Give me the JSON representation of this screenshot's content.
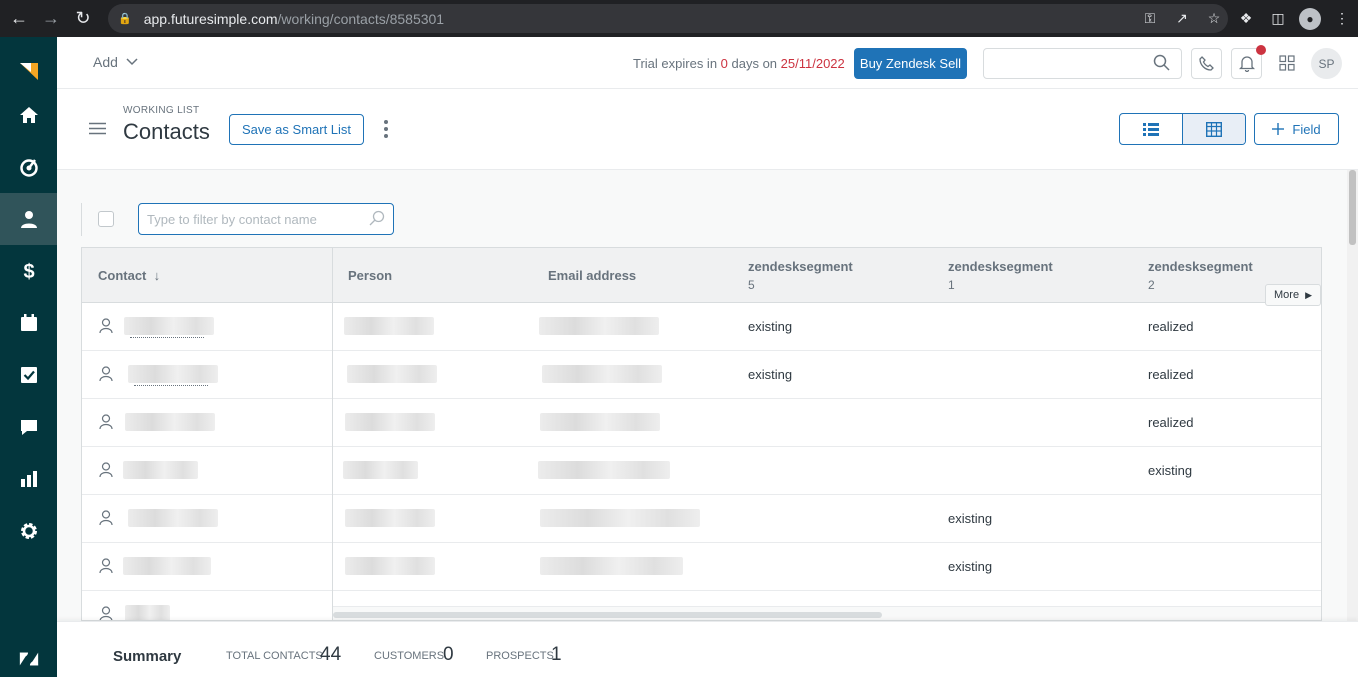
{
  "browser": {
    "url_host": "app.futuresimple.com",
    "url_path": "/working/contacts/8585301",
    "profile_initial": "●"
  },
  "colors": {
    "sidebar_bg": "#03363d",
    "sidebar_active": "#30545a",
    "primary": "#1f73b7",
    "alert": "#cc3340",
    "logo_accent": "#f5a623"
  },
  "sidebar": {
    "items": [
      {
        "icon": "zendesk-sell-logo-icon"
      },
      {
        "icon": "home-icon"
      },
      {
        "icon": "leads-icon"
      },
      {
        "icon": "contacts-icon",
        "active": true
      },
      {
        "icon": "deals-dollar-icon"
      },
      {
        "icon": "calendar-icon"
      },
      {
        "icon": "tasks-check-icon"
      },
      {
        "icon": "chat-icon"
      },
      {
        "icon": "reports-icon"
      },
      {
        "icon": "settings-gear-icon"
      },
      {
        "icon": "zendesk-logo-icon"
      }
    ]
  },
  "header": {
    "add_label": "Add",
    "trial_prefix": "Trial expires in ",
    "trial_days": "0",
    "trial_middle": " days on ",
    "trial_date": "25/11/2022",
    "buy_label": "Buy Zendesk Sell",
    "search_value": "",
    "avatar_initials": "SP"
  },
  "titlebar": {
    "subtitle": "WORKING LIST",
    "title": "Contacts",
    "smart_list_label": "Save as Smart List",
    "field_label": "Field"
  },
  "filter": {
    "placeholder": "Type to filter by contact name"
  },
  "table": {
    "columns": [
      {
        "label": "Contact",
        "sub": "",
        "sort": "↓"
      },
      {
        "label": "Person",
        "sub": ""
      },
      {
        "label": "Email address",
        "sub": ""
      },
      {
        "label": "zendesksegment",
        "sub": "5"
      },
      {
        "label": "zendesksegment",
        "sub": "1"
      },
      {
        "label": "zendesksegment",
        "sub": "2"
      }
    ],
    "more_label": "More",
    "rows": [
      {
        "seg5": "existing",
        "seg1": "",
        "seg2": "realized"
      },
      {
        "seg5": "existing",
        "seg1": "",
        "seg2": "realized"
      },
      {
        "seg5": "",
        "seg1": "",
        "seg2": "realized"
      },
      {
        "seg5": "",
        "seg1": "",
        "seg2": "existing"
      },
      {
        "seg5": "",
        "seg1": "existing",
        "seg2": ""
      },
      {
        "seg5": "",
        "seg1": "existing",
        "seg2": ""
      },
      {
        "seg5": "",
        "seg1": "",
        "seg2": ""
      }
    ]
  },
  "summary": {
    "title": "Summary",
    "total_label": "TOTAL CONTACTS",
    "total_value": "44",
    "customers_label": "CUSTOMERS",
    "customers_value": "0",
    "prospects_label": "PROSPECTS",
    "prospects_value": "1"
  }
}
